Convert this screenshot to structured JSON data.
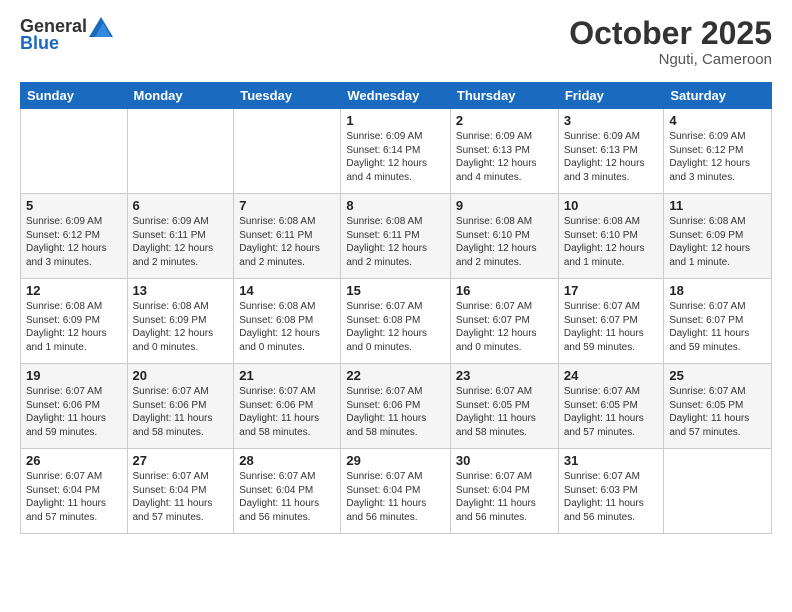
{
  "header": {
    "logo_general": "General",
    "logo_blue": "Blue",
    "month": "October 2025",
    "location": "Nguti, Cameroon"
  },
  "calendar": {
    "days_of_week": [
      "Sunday",
      "Monday",
      "Tuesday",
      "Wednesday",
      "Thursday",
      "Friday",
      "Saturday"
    ],
    "weeks": [
      [
        {
          "day": "",
          "info": ""
        },
        {
          "day": "",
          "info": ""
        },
        {
          "day": "",
          "info": ""
        },
        {
          "day": "1",
          "info": "Sunrise: 6:09 AM\nSunset: 6:14 PM\nDaylight: 12 hours\nand 4 minutes."
        },
        {
          "day": "2",
          "info": "Sunrise: 6:09 AM\nSunset: 6:13 PM\nDaylight: 12 hours\nand 4 minutes."
        },
        {
          "day": "3",
          "info": "Sunrise: 6:09 AM\nSunset: 6:13 PM\nDaylight: 12 hours\nand 3 minutes."
        },
        {
          "day": "4",
          "info": "Sunrise: 6:09 AM\nSunset: 6:12 PM\nDaylight: 12 hours\nand 3 minutes."
        }
      ],
      [
        {
          "day": "5",
          "info": "Sunrise: 6:09 AM\nSunset: 6:12 PM\nDaylight: 12 hours\nand 3 minutes."
        },
        {
          "day": "6",
          "info": "Sunrise: 6:09 AM\nSunset: 6:11 PM\nDaylight: 12 hours\nand 2 minutes."
        },
        {
          "day": "7",
          "info": "Sunrise: 6:08 AM\nSunset: 6:11 PM\nDaylight: 12 hours\nand 2 minutes."
        },
        {
          "day": "8",
          "info": "Sunrise: 6:08 AM\nSunset: 6:11 PM\nDaylight: 12 hours\nand 2 minutes."
        },
        {
          "day": "9",
          "info": "Sunrise: 6:08 AM\nSunset: 6:10 PM\nDaylight: 12 hours\nand 2 minutes."
        },
        {
          "day": "10",
          "info": "Sunrise: 6:08 AM\nSunset: 6:10 PM\nDaylight: 12 hours\nand 1 minute."
        },
        {
          "day": "11",
          "info": "Sunrise: 6:08 AM\nSunset: 6:09 PM\nDaylight: 12 hours\nand 1 minute."
        }
      ],
      [
        {
          "day": "12",
          "info": "Sunrise: 6:08 AM\nSunset: 6:09 PM\nDaylight: 12 hours\nand 1 minute."
        },
        {
          "day": "13",
          "info": "Sunrise: 6:08 AM\nSunset: 6:09 PM\nDaylight: 12 hours\nand 0 minutes."
        },
        {
          "day": "14",
          "info": "Sunrise: 6:08 AM\nSunset: 6:08 PM\nDaylight: 12 hours\nand 0 minutes."
        },
        {
          "day": "15",
          "info": "Sunrise: 6:07 AM\nSunset: 6:08 PM\nDaylight: 12 hours\nand 0 minutes."
        },
        {
          "day": "16",
          "info": "Sunrise: 6:07 AM\nSunset: 6:07 PM\nDaylight: 12 hours\nand 0 minutes."
        },
        {
          "day": "17",
          "info": "Sunrise: 6:07 AM\nSunset: 6:07 PM\nDaylight: 11 hours\nand 59 minutes."
        },
        {
          "day": "18",
          "info": "Sunrise: 6:07 AM\nSunset: 6:07 PM\nDaylight: 11 hours\nand 59 minutes."
        }
      ],
      [
        {
          "day": "19",
          "info": "Sunrise: 6:07 AM\nSunset: 6:06 PM\nDaylight: 11 hours\nand 59 minutes."
        },
        {
          "day": "20",
          "info": "Sunrise: 6:07 AM\nSunset: 6:06 PM\nDaylight: 11 hours\nand 58 minutes."
        },
        {
          "day": "21",
          "info": "Sunrise: 6:07 AM\nSunset: 6:06 PM\nDaylight: 11 hours\nand 58 minutes."
        },
        {
          "day": "22",
          "info": "Sunrise: 6:07 AM\nSunset: 6:06 PM\nDaylight: 11 hours\nand 58 minutes."
        },
        {
          "day": "23",
          "info": "Sunrise: 6:07 AM\nSunset: 6:05 PM\nDaylight: 11 hours\nand 58 minutes."
        },
        {
          "day": "24",
          "info": "Sunrise: 6:07 AM\nSunset: 6:05 PM\nDaylight: 11 hours\nand 57 minutes."
        },
        {
          "day": "25",
          "info": "Sunrise: 6:07 AM\nSunset: 6:05 PM\nDaylight: 11 hours\nand 57 minutes."
        }
      ],
      [
        {
          "day": "26",
          "info": "Sunrise: 6:07 AM\nSunset: 6:04 PM\nDaylight: 11 hours\nand 57 minutes."
        },
        {
          "day": "27",
          "info": "Sunrise: 6:07 AM\nSunset: 6:04 PM\nDaylight: 11 hours\nand 57 minutes."
        },
        {
          "day": "28",
          "info": "Sunrise: 6:07 AM\nSunset: 6:04 PM\nDaylight: 11 hours\nand 56 minutes."
        },
        {
          "day": "29",
          "info": "Sunrise: 6:07 AM\nSunset: 6:04 PM\nDaylight: 11 hours\nand 56 minutes."
        },
        {
          "day": "30",
          "info": "Sunrise: 6:07 AM\nSunset: 6:04 PM\nDaylight: 11 hours\nand 56 minutes."
        },
        {
          "day": "31",
          "info": "Sunrise: 6:07 AM\nSunset: 6:03 PM\nDaylight: 11 hours\nand 56 minutes."
        },
        {
          "day": "",
          "info": ""
        }
      ]
    ]
  }
}
